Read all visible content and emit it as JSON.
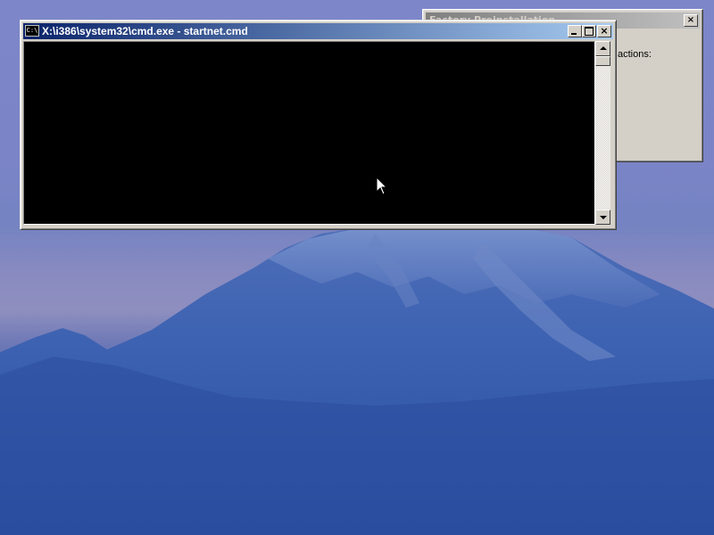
{
  "desktop": {
    "wallpaper_icon": "mountain-wallpaper"
  },
  "background_dialog": {
    "title": "Factory Preinstallation",
    "close_label": "×",
    "visible_text": "actions:"
  },
  "cmd_window": {
    "title": "X:\\i386\\system32\\cmd.exe - startnet.cmd",
    "icon_text": "C:\\",
    "buttons": {
      "minimize_icon": "minimize-icon",
      "maximize_icon": "maximize-icon",
      "close_label": "×"
    }
  },
  "colors": {
    "titlebar_start": "#0a246a",
    "titlebar_end": "#a6caf0",
    "console_bg": "#000000",
    "window_face": "#d4d0c8"
  }
}
